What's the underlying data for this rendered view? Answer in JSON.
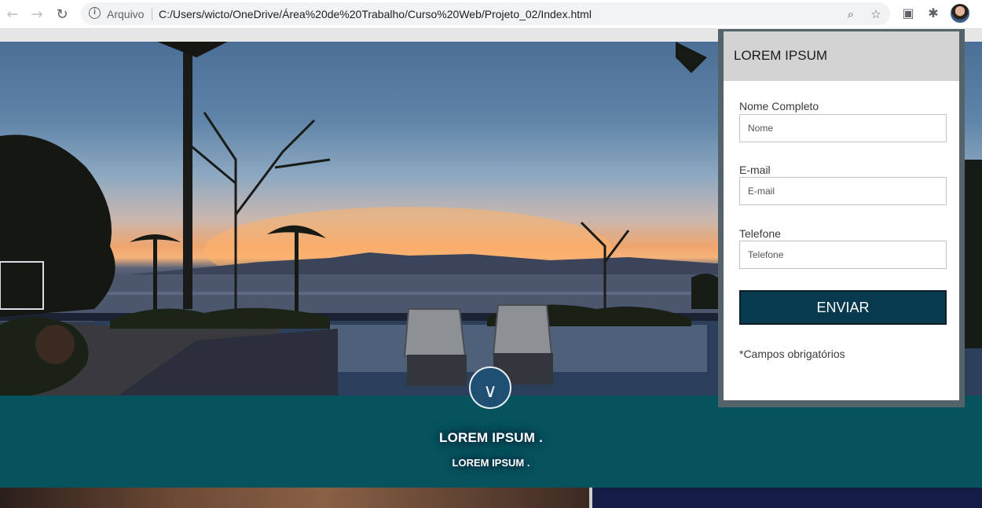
{
  "browser": {
    "scheme_label": "Arquivo",
    "url": "C:/Users/wicto/OneDrive/Área%20de%20Trabalho/Curso%20Web/Projeto_02/Index.html",
    "icons": [
      "back-arrow-icon",
      "forward-arrow-icon",
      "reload-icon",
      "info-icon",
      "zoom-icon",
      "star-icon",
      "cast-icon",
      "extensions-icon",
      "avatar"
    ]
  },
  "hero": {
    "scroll_button_glyph": "∨"
  },
  "band": {
    "title": "LOREM IPSUM .",
    "subtitle": "LOREM IPSUM ."
  },
  "form": {
    "title": "LOREM IPSUM",
    "fields": [
      {
        "label": "Nome Completo",
        "placeholder": "Nome",
        "value": ""
      },
      {
        "label": "E-mail",
        "placeholder": "E-mail",
        "value": ""
      },
      {
        "label": "Telefone",
        "placeholder": "Telefone",
        "value": ""
      }
    ],
    "submit_label": "ENVIAR",
    "required_note": "*Campos obrigatórios"
  },
  "colors": {
    "band": "#07535d",
    "submit": "#073a4e",
    "form_header": "#d3d3d3",
    "bottom_right": "#141d45"
  }
}
